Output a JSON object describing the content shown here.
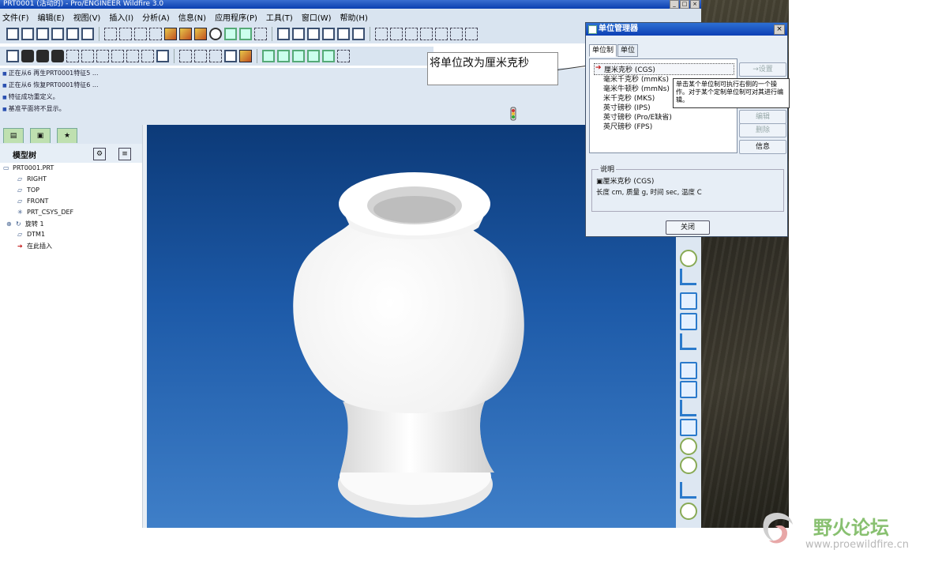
{
  "window": {
    "title": "PRT0001 (活动的) - Pro/ENGINEER Wildfire 3.0",
    "min": "_",
    "max": "□",
    "close": "×"
  },
  "menu": [
    "文件(F)",
    "编辑(E)",
    "视图(V)",
    "插入(I)",
    "分析(A)",
    "信息(N)",
    "应用程序(P)",
    "工具(T)",
    "窗口(W)",
    "帮助(H)"
  ],
  "messages": [
    "正在从6 再生PRT0001特征5 ...",
    "正在从6 恢复PRT0001特征6 ...",
    "特征成功重定义。",
    "基准平面将不显示。"
  ],
  "annotation": "将单位改为厘米克秒",
  "model_tree": {
    "title": "模型树",
    "items": [
      "PRT0001.PRT",
      "RIGHT",
      "TOP",
      "FRONT",
      "PRT_CSYS_DEF",
      "旋转 1",
      "DTM1",
      "在此插入"
    ]
  },
  "units_dialog": {
    "title": "单位管理器",
    "tabs": [
      "单位制",
      "单位"
    ],
    "systems": [
      "厘米克秒 (CGS)",
      "毫米千克秒 (mmKs)",
      "毫米牛顿秒 (mmNs)",
      "米千克秒 (MKS)",
      "英寸磅秒 (IPS)",
      "英寸磅秒 (Pro/E缺省)",
      "英尺磅秒 (FPS)"
    ],
    "buttons": {
      "set": "→设置",
      "edit": "编辑",
      "delete": "删除",
      "info": "信息"
    },
    "tooltip": "单击某个单位制可执行右侧的一个操作。对于某个定制单位制可对其进行编辑。",
    "description": {
      "label": "说明",
      "name": "厘米克秒 (CGS)",
      "values": "长度 cm, 质量 g, 时间 sec, 温度 C"
    },
    "close": "关闭"
  },
  "watermark": {
    "text": "野火论坛",
    "url": "www.proewildfire.cn"
  }
}
